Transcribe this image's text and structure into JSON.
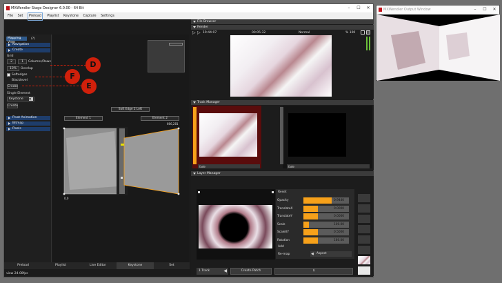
{
  "main_window": {
    "title": "MXWendler Stage Designer 6.0.00  -  64 Bit",
    "menu": [
      "File",
      "Set",
      "Preload",
      "Playlist",
      "Keystone",
      "Capture",
      "Settings"
    ]
  },
  "output_window": {
    "title": "MXWendler Output Window"
  },
  "left_panel": {
    "mapping_view_label": "Mapping View",
    "mapping_view_badge": "(?)",
    "navigation": "Navigation",
    "create": "Create",
    "grid_label": "Grid",
    "cols": "2",
    "rows": "1",
    "columns_rows_label": "Columns/Rows",
    "overlap_value": "10%",
    "overlap_label": "Overlap",
    "softedges_label": "Softedges",
    "blacklevel_label": "Blacklevel",
    "create_button": "Create",
    "single_element_label": "Single Element",
    "keystone_option": "Keystone",
    "create_button2": "Create",
    "pivot_animation": "Pivot Animation",
    "bitmap": "Bitmap",
    "pixels": "Pixels"
  },
  "callouts": {
    "d": "D",
    "f": "F",
    "e": "E"
  },
  "canvas": {
    "element1": "Element 1",
    "element2": "Element 2",
    "soft_edge_tag": "Soft Edge 2 Left",
    "coord_top": "666,281",
    "coord_bottom": "0,0"
  },
  "bottom_tabs": [
    "Preload",
    "Playlist",
    "Live Editor",
    "Keystone",
    "Set"
  ],
  "active_tab": "Keystone",
  "status": "view 24.00fps",
  "file_browser": {
    "title": "File Browser"
  },
  "render": {
    "title": "Render",
    "time": "19:44:07",
    "duration": "00:05:32",
    "mode": "Normal",
    "percent": "% 100"
  },
  "track_manager": {
    "title": "Track Manager",
    "fade1": "fade",
    "fade2": "fade"
  },
  "layer_manager": {
    "title": "Layer Manager",
    "reset": "Reset",
    "props": [
      {
        "label": "Opacity",
        "value": "0.9440",
        "fill": 0.62
      },
      {
        "label": "TranslateX",
        "value": "0.0000",
        "fill": 0.32
      },
      {
        "label": "TranslateY",
        "value": "0.0000",
        "fill": 0.32
      },
      {
        "label": "Scale",
        "value": "100.00",
        "fill": 0.12
      },
      {
        "label": "ScaleXY",
        "value": "0.5000",
        "fill": 0.32
      },
      {
        "label": "Rotation",
        "value": "180.00",
        "fill": 0.32
      }
    ],
    "add_label": "Add",
    "remap_label": "Re-map",
    "aspect_value": "Aspect",
    "track_select": "1 Track",
    "create_patch": "Create Patch",
    "page_value": "$"
  },
  "colors": {
    "accent": "#f7a11a",
    "callout": "#d0200b",
    "panel_blue": "#1e3d6b",
    "track_red": "#5a0c0c"
  }
}
